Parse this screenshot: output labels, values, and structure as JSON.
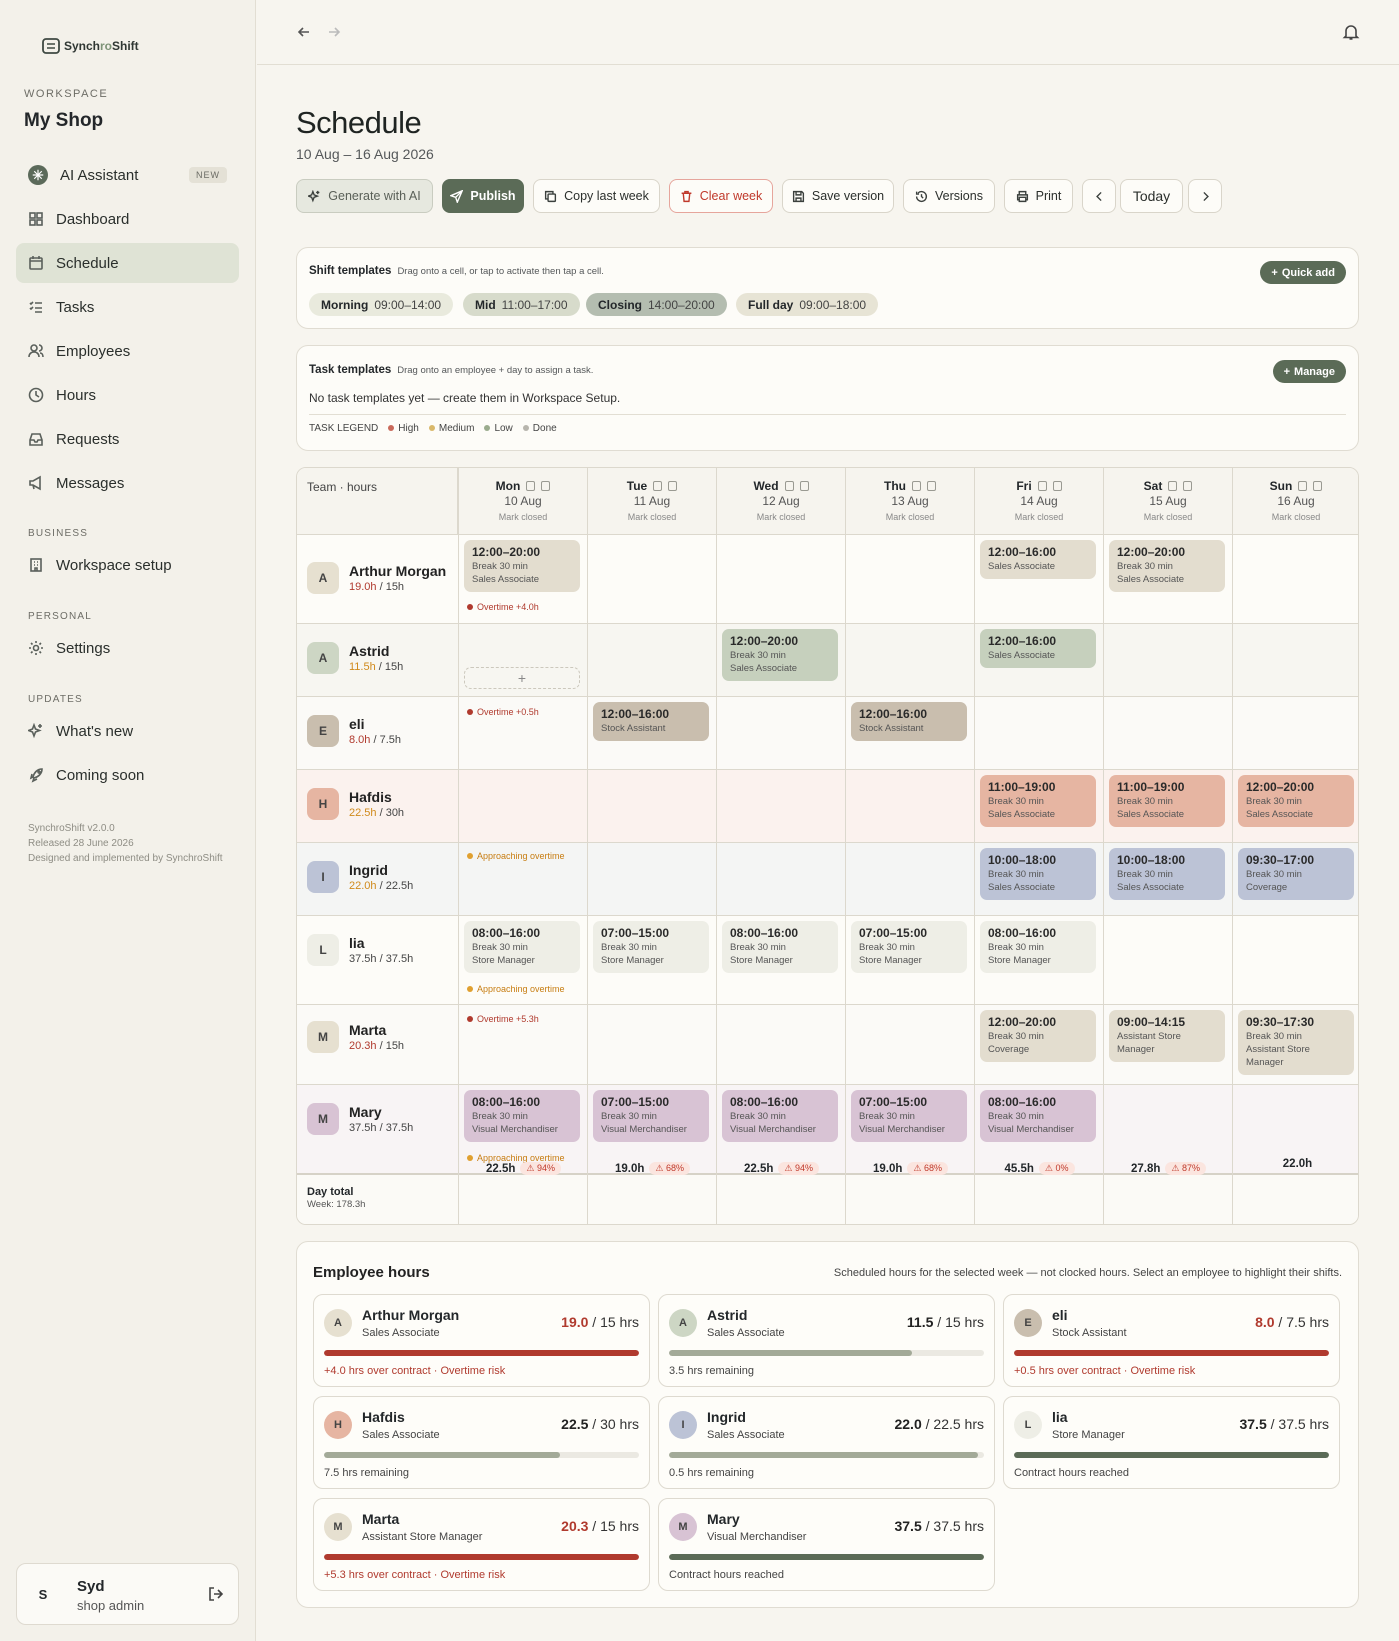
{
  "app": {
    "logo_prefix": "Synch",
    "logo_mid": "ro",
    "logo_suffix": "Shift"
  },
  "workspace": {
    "label": "WORKSPACE",
    "name": "My Shop"
  },
  "nav": {
    "ai": "AI Assistant",
    "ai_badge": "NEW",
    "dashboard": "Dashboard",
    "schedule": "Schedule",
    "tasks": "Tasks",
    "employees": "Employees",
    "hours": "Hours",
    "requests": "Requests",
    "messages": "Messages",
    "business_label": "BUSINESS",
    "workspace_setup": "Workspace setup",
    "personal_label": "PERSONAL",
    "settings": "Settings",
    "updates_label": "UPDATES",
    "whats_new": "What's new",
    "coming_soon": "Coming soon"
  },
  "version": {
    "v": "SynchroShift v2.0.0",
    "released": "Released 28 June 2026",
    "credit": "Designed and implemented by SynchroShift"
  },
  "user": {
    "initial": "S",
    "name": "Syd",
    "role": "shop admin"
  },
  "page": {
    "title": "Schedule",
    "range": "10 Aug – 16 Aug 2026"
  },
  "toolbar": {
    "generate": "Generate with AI",
    "publish": "Publish",
    "copy": "Copy last week",
    "clear": "Clear week",
    "save": "Save version",
    "versions": "Versions",
    "print": "Print",
    "today": "Today"
  },
  "shift_templates": {
    "title": "Shift templates",
    "hint": "Drag onto a cell, or tap to activate then tap a cell.",
    "quick_add": "Quick add",
    "items": [
      {
        "name": "Morning",
        "time": "09:00–14:00"
      },
      {
        "name": "Mid",
        "time": "11:00–17:00"
      },
      {
        "name": "Closing",
        "time": "14:00–20:00"
      },
      {
        "name": "Full day",
        "time": "09:00–18:00"
      }
    ]
  },
  "task_templates": {
    "title": "Task templates",
    "hint": "Drag onto an employee + day to assign a task.",
    "manage": "Manage",
    "empty": "No task templates yet — create them in Workspace Setup.",
    "legend_label": "TASK LEGEND",
    "legend": [
      "High",
      "Medium",
      "Low",
      "Done"
    ],
    "legend_colors": [
      "#c9695a",
      "#d9b86a",
      "#9aab8d",
      "#b7b5ad"
    ]
  },
  "grid": {
    "corner": "Team · hours",
    "mark_closed": "Mark closed",
    "days": [
      {
        "d": "Mon",
        "date": "10 Aug"
      },
      {
        "d": "Tue",
        "date": "11 Aug"
      },
      {
        "d": "Wed",
        "date": "12 Aug"
      },
      {
        "d": "Thu",
        "date": "13 Aug"
      },
      {
        "d": "Fri",
        "date": "14 Aug"
      },
      {
        "d": "Sat",
        "date": "15 Aug"
      },
      {
        "d": "Sun",
        "date": "16 Aug"
      }
    ],
    "employees": [
      {
        "initial": "A",
        "name": "Arthur Morgan",
        "sched": "19.0h",
        "contract": " / 15h"
      },
      {
        "initial": "A",
        "name": "Astrid",
        "sched": "11.5h",
        "contract": " / 15h"
      },
      {
        "initial": "E",
        "name": "eli",
        "sched": "8.0h",
        "contract": " / 7.5h"
      },
      {
        "initial": "H",
        "name": "Hafdis",
        "sched": "22.5h",
        "contract": " / 30h"
      },
      {
        "initial": "I",
        "name": "Ingrid",
        "sched": "22.0h",
        "contract": " / 22.5h"
      },
      {
        "initial": "L",
        "name": "lia",
        "sched": "37.5h",
        "contract": " / 37.5h"
      },
      {
        "initial": "M",
        "name": "Marta",
        "sched": "20.3h",
        "contract": " / 15h"
      },
      {
        "initial": "M",
        "name": "Mary",
        "sched": "37.5h",
        "contract": " / 37.5h"
      }
    ],
    "shifts": {
      "break": "Break 30 min",
      "arthur_mon": {
        "t": "12:00–20:00",
        "r": "Sales Associate"
      },
      "arthur_fri": {
        "t": "12:00–16:00",
        "r": "Sales Associate"
      },
      "arthur_sat": {
        "t": "12:00–20:00",
        "r": "Sales Associate"
      },
      "astrid_wed": {
        "t": "12:00–20:00",
        "r": "Sales Associate"
      },
      "astrid_fri": {
        "t": "12:00–16:00",
        "r": "Sales Associate"
      },
      "eli_tue": {
        "t": "12:00–16:00",
        "r": "Stock Assistant"
      },
      "eli_thu": {
        "t": "12:00–16:00",
        "r": "Stock Assistant"
      },
      "hafdis_fri": {
        "t": "11:00–19:00",
        "r": "Sales Associate"
      },
      "hafdis_sat": {
        "t": "11:00–19:00",
        "r": "Sales Associate"
      },
      "hafdis_sun": {
        "t": "12:00–20:00",
        "r": "Sales Associate"
      },
      "ingrid_fri": {
        "t": "10:00–18:00",
        "r": "Sales Associate"
      },
      "ingrid_sat": {
        "t": "10:00–18:00",
        "r": "Sales Associate"
      },
      "ingrid_sun": {
        "t": "09:30–17:00",
        "r": "Coverage"
      },
      "lia_mon": {
        "t": "08:00–16:00",
        "r": "Store Manager"
      },
      "lia_tue": {
        "t": "07:00–15:00",
        "r": "Store Manager"
      },
      "lia_wed": {
        "t": "08:00–16:00",
        "r": "Store Manager"
      },
      "lia_thu": {
        "t": "07:00–15:00",
        "r": "Store Manager"
      },
      "lia_fri": {
        "t": "08:00–16:00",
        "r": "Store Manager"
      },
      "marta_fri": {
        "t": "12:00–20:00",
        "r": "Coverage"
      },
      "marta_sat": {
        "t": "09:00–14:15",
        "r": "Assistant Store Manager"
      },
      "marta_sun": {
        "t": "09:30–17:30",
        "r": "Assistant Store Manager"
      },
      "mary_mon": {
        "t": "08:00–16:00",
        "r": "Visual Merchandiser"
      },
      "mary_tue": {
        "t": "07:00–15:00",
        "r": "Visual Merchandiser"
      },
      "mary_wed": {
        "t": "08:00–16:00",
        "r": "Visual Merchandiser"
      },
      "mary_thu": {
        "t": "07:00–15:00",
        "r": "Visual Merchandiser"
      },
      "mary_fri": {
        "t": "08:00–16:00",
        "r": "Visual Merchandiser"
      }
    },
    "flags": {
      "arthur": "Overtime +4.0h",
      "eli": "Overtime +0.5h",
      "ingrid": "Approaching overtime",
      "lia": "Approaching overtime",
      "marta": "Overtime +5.3h",
      "mary": "Approaching overtime"
    },
    "totals": {
      "label": "Day total",
      "week": "Week: 178.3h",
      "days": [
        {
          "h": "22.5h",
          "p": "94%"
        },
        {
          "h": "19.0h",
          "p": "68%"
        },
        {
          "h": "22.5h",
          "p": "94%"
        },
        {
          "h": "19.0h",
          "p": "68%"
        },
        {
          "h": "45.5h",
          "p": "0%"
        },
        {
          "h": "27.8h",
          "p": "87%"
        },
        {
          "h": "22.0h",
          "p": ""
        }
      ]
    }
  },
  "employee_hours": {
    "title": "Employee hours",
    "subtitle": "Scheduled hours for the selected week — not clocked hours. Select an employee to highlight their shifts.",
    "cards": [
      {
        "initial": "A",
        "name": "Arthur Morgan",
        "role": "Sales Associate",
        "sched": "19.0",
        "contract": " / 15 hrs",
        "note": "+4.0 hrs over contract · Overtime risk",
        "fill": 1.0,
        "over": true
      },
      {
        "initial": "A",
        "name": "Astrid",
        "role": "Sales Associate",
        "sched": "11.5",
        "contract": " / 15 hrs",
        "note": "3.5 hrs remaining",
        "fill": 0.77,
        "over": false
      },
      {
        "initial": "E",
        "name": "eli",
        "role": "Stock Assistant",
        "sched": "8.0",
        "contract": " / 7.5 hrs",
        "note": "+0.5 hrs over contract · Overtime risk",
        "fill": 1.0,
        "over": true
      },
      {
        "initial": "H",
        "name": "Hafdis",
        "role": "Sales Associate",
        "sched": "22.5",
        "contract": " / 30 hrs",
        "note": "7.5 hrs remaining",
        "fill": 0.75,
        "over": false
      },
      {
        "initial": "I",
        "name": "Ingrid",
        "role": "Sales Associate",
        "sched": "22.0",
        "contract": " / 22.5 hrs",
        "note": "0.5 hrs remaining",
        "fill": 0.98,
        "over": false
      },
      {
        "initial": "L",
        "name": "lia",
        "role": "Store Manager",
        "sched": "37.5",
        "contract": " / 37.5 hrs",
        "note": "Contract hours reached",
        "fill": 1.0,
        "over": false
      },
      {
        "initial": "M",
        "name": "Marta",
        "role": "Assistant Store Manager",
        "sched": "20.3",
        "contract": " / 15 hrs",
        "note": "+5.3 hrs over contract · Overtime risk",
        "fill": 1.0,
        "over": true
      },
      {
        "initial": "M",
        "name": "Mary",
        "role": "Visual Merchandiser",
        "sched": "37.5",
        "contract": " / 37.5 hrs",
        "note": "Contract hours reached",
        "fill": 1.0,
        "over": false
      }
    ]
  }
}
